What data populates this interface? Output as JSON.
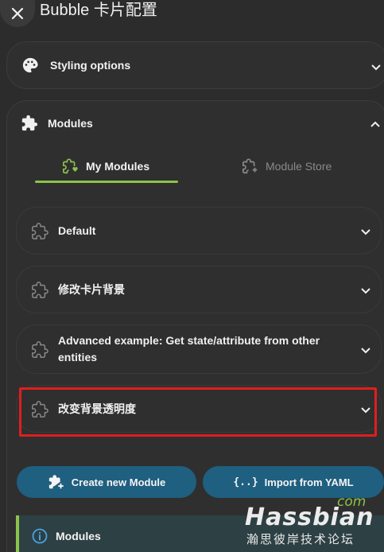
{
  "header": {
    "title": "Bubble 卡片配置"
  },
  "styling": {
    "label": "Styling options"
  },
  "modules": {
    "label": "Modules",
    "tabs": [
      {
        "label": "My Modules",
        "active": true
      },
      {
        "label": "Module Store",
        "active": false
      }
    ],
    "items": [
      {
        "label": "Default"
      },
      {
        "label": "修改卡片背景"
      },
      {
        "label": "Advanced example: Get state/attribute from other entities"
      },
      {
        "label": "改变背景透明度",
        "highlighted": true
      }
    ],
    "actions": {
      "create_label": "Create new Module",
      "import_label": "Import from YAML",
      "import_icon_text": "{..}"
    },
    "info_label": "Modules"
  },
  "watermark": {
    "brand": "Hassbian",
    "tld": "com",
    "tagline": "瀚思彼岸技术论坛"
  },
  "colors": {
    "accent": "#8bc34a",
    "button": "#1f5f80",
    "highlight": "#e01e1e",
    "background": "#2c2c2c"
  }
}
